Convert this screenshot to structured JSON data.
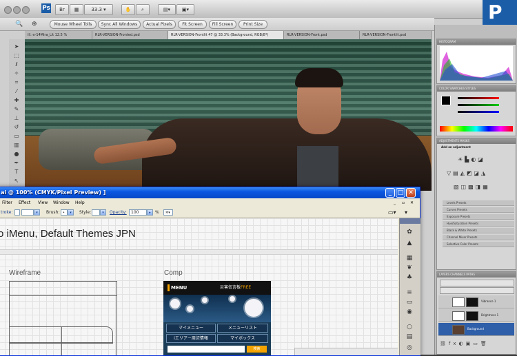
{
  "photoshop": {
    "badge": "P",
    "zoom": "33.3",
    "title_buttons": [
      "Mini Bridge",
      "Screen Mode",
      "Workspace"
    ],
    "options_bar": [
      "Mouse Wheel Tolls",
      "Sync All Windows",
      "Actual Pixels",
      "Fit Screen",
      "Fill Screen",
      "Print Size"
    ],
    "tabs": [
      {
        "label": "ill.-x-14Mira_Lit 12.5 %",
        "active": false
      },
      {
        "label": "RLR-VERSION-Fronted.psd",
        "active": false
      },
      {
        "label": "RLR-VERSION-Frontlit 47 @ 33.3% (Background, RGB/8*)",
        "active": true
      },
      {
        "label": "RLR-VERSION-Front.psd",
        "active": false
      },
      {
        "label": "RLR-VERSION-Frontlit.psd",
        "active": false
      }
    ],
    "panels": {
      "histogram_label": "HISTOGRAM",
      "color_label": "COLOR  SWATCHES  STYLES",
      "adjustments_label": "ADJUSTMENTS  MASKS",
      "adjustments_title": "Add an adjustment",
      "presets": [
        "Levels Presets",
        "Curves Presets",
        "Exposure Presets",
        "Hue/Saturation Presets",
        "Black & White Presets",
        "Channel Mixer Presets",
        "Selective Color Presets"
      ],
      "layers_label": "LAYERS  CHANNELS  PATHS",
      "layers": [
        {
          "name": "Vibrance 1",
          "selected": false
        },
        {
          "name": "Brightness 1",
          "selected": false
        },
        {
          "name": "Background",
          "selected": true
        }
      ]
    }
  },
  "illustrator": {
    "title": "ai @ 100% (CMYK/Pixel Preview) ]",
    "menus": [
      "Filter",
      "Effect",
      "View",
      "Window",
      "Help"
    ],
    "control": {
      "stroke_label": "troke:",
      "brush_label": "Brush:",
      "style_label": "Style:",
      "opacity_label": "Opacity:",
      "opacity_value": "100",
      "percent": "%"
    },
    "heading": "o iMenu, Default Themes JPN",
    "wireframe_label": "Wireframe",
    "comp_label": "Comp",
    "comp": {
      "menu_label": "MENU",
      "free_prefix": "災害伝言板",
      "free_suffix": "FREE",
      "buttons": [
        "マイメニュー",
        "メニューリスト",
        "iエリア－周辺情報",
        "マイボックス"
      ],
      "search_button": "検索"
    },
    "window_buttons": {
      "minimize": "_",
      "maximize": "□",
      "close": "✕"
    }
  },
  "colors": {
    "xp_title": "#0a56e0",
    "ps_blue": "#1c5da8",
    "comp_accent": "#f5a300"
  }
}
